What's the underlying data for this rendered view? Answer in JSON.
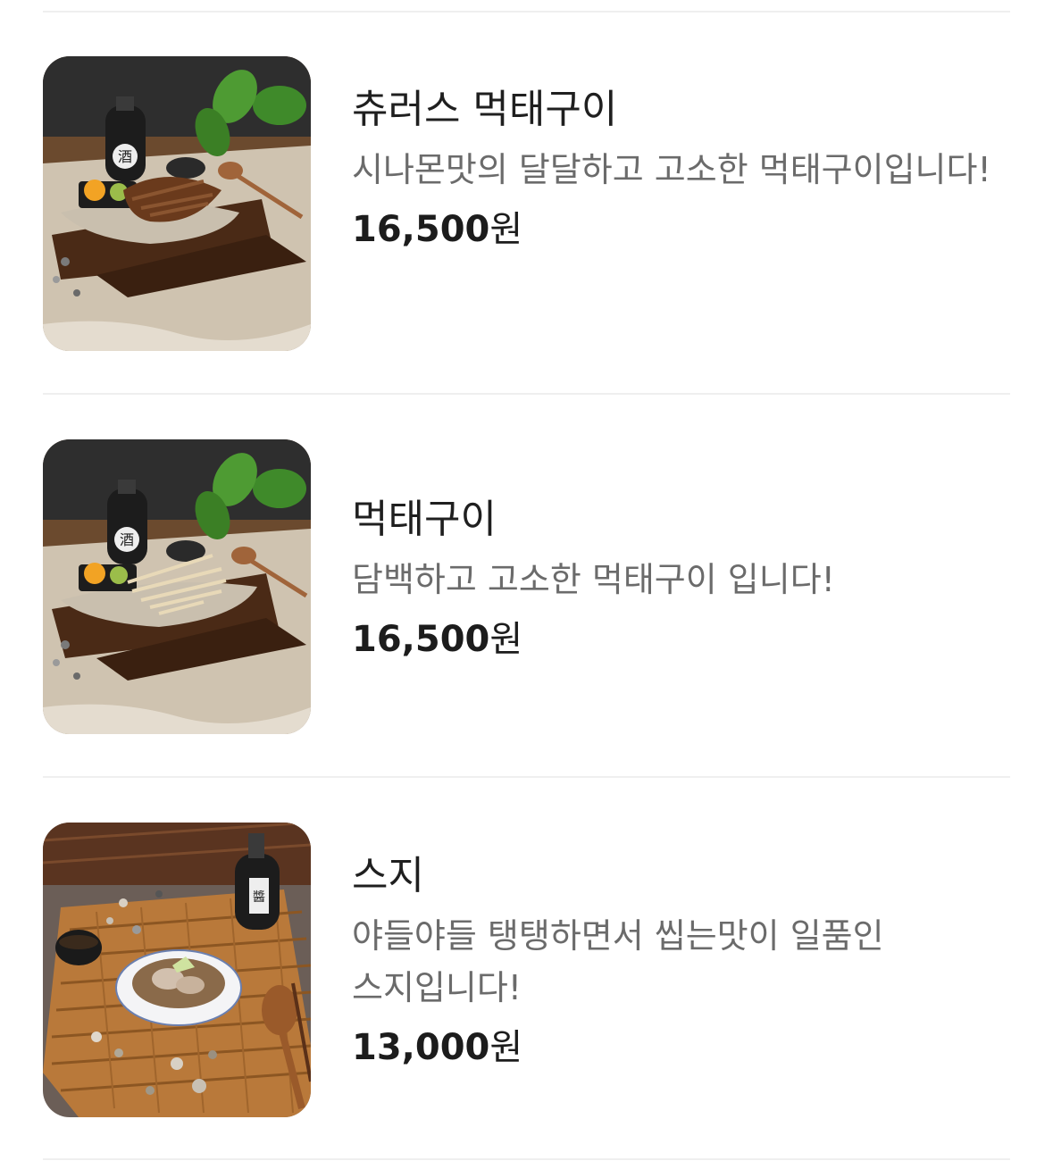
{
  "menu": {
    "items": [
      {
        "name": "츄러스 먹태구이",
        "description": "시나몬맛의 달달하고 고소한 먹태구이입니다!",
        "price": "16,500",
        "currency": "원",
        "image_icon": "dried-pollack-platter-photo"
      },
      {
        "name": "먹태구이",
        "description": "담백하고 고소한 먹태구이 입니다!",
        "price": "16,500",
        "currency": "원",
        "image_icon": "dried-pollack-platter-photo"
      },
      {
        "name": "스지",
        "description": "야들야들 탱탱하면서 씹는맛이 일품인 스지입니다!",
        "price": "13,000",
        "currency": "원",
        "image_icon": "beef-tendon-bowl-photo"
      }
    ]
  }
}
